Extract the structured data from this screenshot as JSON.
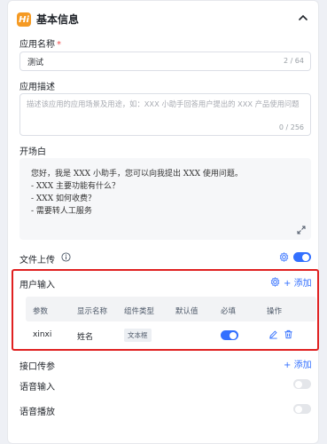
{
  "header": {
    "badge": "Hi",
    "title": "基本信息"
  },
  "app_name": {
    "label": "应用名称",
    "required_mark": "*",
    "value": "测试",
    "counter": "2 / 64"
  },
  "app_desc": {
    "label": "应用描述",
    "placeholder": "描述该应用的应用场景及用途，如：XXX 小助手回答用户提出的 XXX 产品使用问题",
    "counter": "0 / 256"
  },
  "opening": {
    "label": "开场白",
    "lines": [
      "您好，我是 XXX 小助手，您可以向我提出 XXX 使用问题。",
      "- XXX 主要功能有什么？",
      "- XXX 如何收费？",
      "- 需要转人工服务"
    ]
  },
  "file_upload": {
    "label": "文件上传",
    "enabled": true
  },
  "user_input": {
    "label": "用户输入",
    "add_label": "添加",
    "columns": [
      "参数",
      "显示名称",
      "组件类型",
      "默认值",
      "必填",
      "操作"
    ],
    "rows": [
      {
        "param": "xinxi",
        "display_name": "姓名",
        "component": "文本框",
        "default": "",
        "required": true
      }
    ]
  },
  "api_params": {
    "label": "接口传参",
    "add_label": "添加"
  },
  "voice_input": {
    "label": "语音输入",
    "enabled": false
  },
  "voice_play": {
    "label": "语音播放",
    "enabled": false
  },
  "colors": {
    "accent": "#3370ff",
    "badge": "#f59a23",
    "highlight": "#e02020"
  }
}
